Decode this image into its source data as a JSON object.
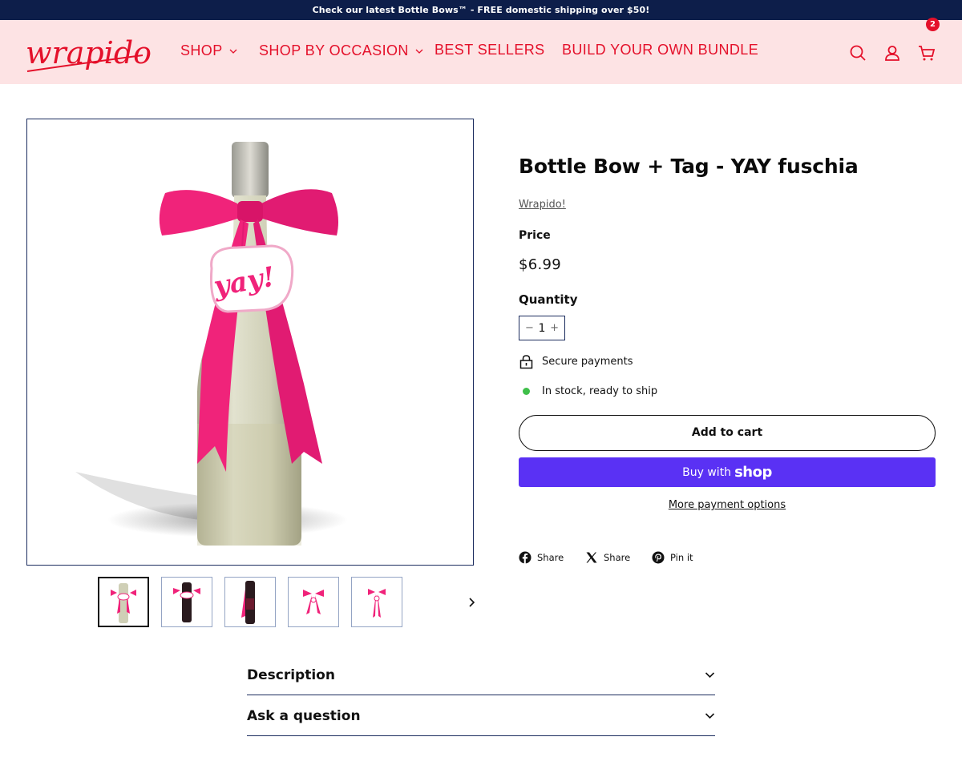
{
  "announcement": {
    "text": "Check our latest Bottle Bows™ - FREE domestic shipping over $50!"
  },
  "header": {
    "logo_text": "wrapido!",
    "nav": [
      "SHOP",
      "SHOP BY OCCASION",
      "BEST SELLERS",
      "BUILD YOUR OWN BUNDLE"
    ],
    "cart_count": "2"
  },
  "product": {
    "title": "Bottle Bow + Tag - YAY fuschia",
    "vendor": "Wrapido!",
    "price_label": "Price",
    "price": "$6.99",
    "quantity_label": "Quantity",
    "quantity": "1",
    "qty_minus": "−",
    "qty_plus": "+",
    "secure": "Secure payments",
    "stock": "In stock, ready to ship",
    "add_to_cart": "Add to cart",
    "buy_with": "Buy with",
    "shop_brand": "shop",
    "more_payment": "More payment options",
    "tag_text": "yay!"
  },
  "share": {
    "facebook": "Share",
    "x": "Share",
    "pinterest": "Pin it"
  },
  "accordions": [
    "Description",
    "Ask a question"
  ],
  "colors": {
    "brand_red": "#e4102a",
    "header_bg": "#fde3e4",
    "announcement_bg": "#0d1e4a",
    "shop_purple": "#5a31f4",
    "ribbon": "#f0237a",
    "in_stock": "#3fbf4a"
  }
}
